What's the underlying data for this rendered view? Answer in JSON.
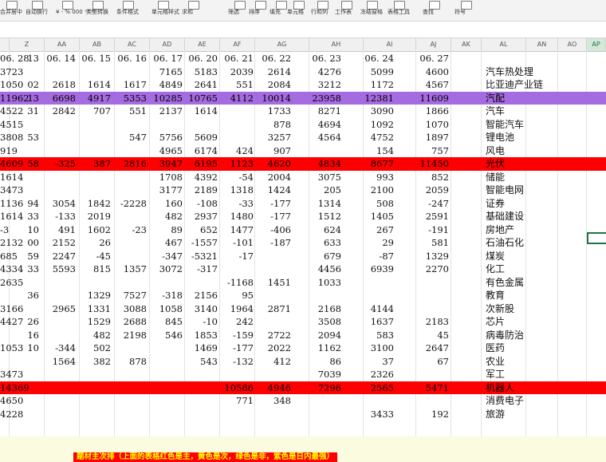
{
  "ribbon": [
    "合并居中",
    "自动换行",
    "¥ - % 000 ⁺⁰ ⁰⁰",
    "类型转换",
    "条件格式",
    "单元格样式",
    "求和",
    "筛选",
    "排序",
    "填充",
    "单元格",
    "行和列",
    "工作表",
    "冻结窗格",
    "表格工具",
    "查找",
    "符号"
  ],
  "columns": [
    "Z",
    "AA",
    "AB",
    "AC",
    "AD",
    "AE",
    "AF",
    "AG",
    "AH",
    "AI",
    "AJ",
    "AK",
    "AL",
    "AN",
    "AO",
    "AP"
  ],
  "rows": [
    {
      "style": "plain",
      "cells": [
        "13",
        "06. 14",
        "06. 15",
        "06. 16",
        "06. 17",
        "06. 20",
        "06. 21",
        "06. 22",
        "06. 23",
        "06. 24",
        "06. 27",
        "06. 28"
      ],
      "label": ""
    },
    {
      "style": "plain",
      "cells": [
        "",
        "",
        "",
        "",
        "7165",
        "5183",
        "2039",
        "2614",
        "4276",
        "5099",
        "4600",
        "3723"
      ],
      "label": "汽车热处理"
    },
    {
      "style": "plain",
      "cells": [
        "02",
        "2618",
        "1614",
        "1617",
        "4849",
        "2641",
        "551",
        "2084",
        "3212",
        "1172",
        "4567",
        "1050"
      ],
      "label": "比亚迪产业链"
    },
    {
      "style": "purple",
      "cells": [
        "13",
        "6698",
        "4917",
        "5353",
        "10285",
        "10765",
        "4112",
        "10014",
        "23958",
        "12381",
        "11609",
        "11962"
      ],
      "label": "汽配"
    },
    {
      "style": "plain",
      "cells": [
        "31",
        "2842",
        "707",
        "551",
        "2137",
        "1614",
        "",
        "1733",
        "8271",
        "3090",
        "1866",
        "4522"
      ],
      "label": "汽车"
    },
    {
      "style": "plain",
      "cells": [
        "",
        "",
        "",
        "",
        "",
        "",
        "",
        "878",
        "4694",
        "1092",
        "1070",
        "4515"
      ],
      "label": "智能汽车"
    },
    {
      "style": "plain",
      "cells": [
        "53",
        "",
        "",
        "547",
        "5756",
        "5609",
        "",
        "3257",
        "4564",
        "4752",
        "1897",
        "3808"
      ],
      "label": "锂电池"
    },
    {
      "style": "plain",
      "cells": [
        "",
        "",
        "",
        "",
        "4965",
        "6174",
        "424",
        "907",
        "",
        "154",
        "757",
        "919"
      ],
      "label": "风电"
    },
    {
      "style": "red",
      "cells": [
        "58",
        "-325",
        "387",
        "2816",
        "3947",
        "6195",
        "1123",
        "4620",
        "4834",
        "8677",
        "11450",
        "4609"
      ],
      "label": "光伏"
    },
    {
      "style": "plain",
      "cells": [
        "",
        "",
        "",
        "",
        "1708",
        "4392",
        "-54",
        "2004",
        "3075",
        "993",
        "852",
        "1614"
      ],
      "label": "储能"
    },
    {
      "style": "plain",
      "cells": [
        "",
        "",
        "",
        "",
        "3177",
        "2189",
        "1318",
        "1424",
        "205",
        "2100",
        "2059",
        "3473"
      ],
      "label": "智能电网"
    },
    {
      "style": "plain",
      "cells": [
        "94",
        "3054",
        "1842",
        "-2228",
        "160",
        "-108",
        "-33",
        "-177",
        "1314",
        "508",
        "-247",
        "1136"
      ],
      "label": "证券"
    },
    {
      "style": "plain",
      "cells": [
        "33",
        "-133",
        "2019",
        "",
        "482",
        "2937",
        "1480",
        "-177",
        "1512",
        "1405",
        "2591",
        "1614"
      ],
      "label": "基础建设"
    },
    {
      "style": "plain",
      "cells": [
        "10",
        "491",
        "1602",
        "-23",
        "89",
        "652",
        "1477",
        "-406",
        "624",
        "267",
        "-191",
        "-3"
      ],
      "label": "房地产"
    },
    {
      "style": "plain",
      "cells": [
        "00",
        "2152",
        "26",
        "",
        "467",
        "-1557",
        "-101",
        "-187",
        "633",
        "29",
        "581",
        "2132"
      ],
      "label": "石油石化"
    },
    {
      "style": "plain",
      "cells": [
        "59",
        "2247",
        "-45",
        "",
        "-347",
        "-5321",
        "-17",
        "",
        "679",
        "-87",
        "1329",
        "685"
      ],
      "label": "煤炭"
    },
    {
      "style": "plain",
      "cells": [
        "33",
        "5593",
        "815",
        "1357",
        "3072",
        "-317",
        "",
        "",
        "4456",
        "6939",
        "2270",
        "4334"
      ],
      "label": "化工"
    },
    {
      "style": "plain",
      "cells": [
        "",
        "",
        "",
        "",
        "",
        "",
        "-1168",
        "1451",
        "1033",
        "",
        "",
        "2635"
      ],
      "label": "有色金属"
    },
    {
      "style": "plain",
      "cells": [
        "36",
        "",
        "1329",
        "7527",
        "-318",
        "2156",
        "95",
        "",
        "",
        "",
        "",
        ""
      ],
      "label": "教育"
    },
    {
      "style": "plain",
      "cells": [
        "",
        "2965",
        "1331",
        "3088",
        "1058",
        "3140",
        "1964",
        "2871",
        "2168",
        "4144",
        "",
        "3166"
      ],
      "label": "次新股"
    },
    {
      "style": "plain",
      "cells": [
        "26",
        "",
        "1529",
        "2688",
        "845",
        "-10",
        "242",
        "",
        "3508",
        "1637",
        "2183",
        "4427"
      ],
      "label": "芯片"
    },
    {
      "style": "plain",
      "cells": [
        "16",
        "",
        "482",
        "2198",
        "546",
        "1853",
        "-159",
        "2722",
        "2094",
        "583",
        "45",
        ""
      ],
      "label": "病毒防治"
    },
    {
      "style": "plain",
      "cells": [
        "10",
        "-344",
        "502",
        "",
        "",
        "1469",
        "-177",
        "2022",
        "1162",
        "3100",
        "2647",
        "1053"
      ],
      "label": "医药"
    },
    {
      "style": "plain",
      "cells": [
        "",
        "1564",
        "382",
        "878",
        "",
        "543",
        "-132",
        "412",
        "86",
        "37",
        "67",
        ""
      ],
      "label": "农业"
    },
    {
      "style": "plain",
      "cells": [
        "",
        "",
        "",
        "",
        "",
        "",
        "",
        "",
        "7039",
        "2326",
        "",
        "3473"
      ],
      "label": "军工"
    },
    {
      "style": "red",
      "cells": [
        "",
        "",
        "",
        "",
        "",
        "",
        "10586",
        "4946",
        "7296",
        "2565",
        "5471",
        "14369"
      ],
      "label": "机器人"
    },
    {
      "style": "plain",
      "cells": [
        "",
        "",
        "",
        "",
        "",
        "",
        "771",
        "348",
        "",
        "",
        "",
        "4650"
      ],
      "label": "消费电子"
    },
    {
      "style": "plain",
      "cells": [
        "",
        "",
        "",
        "",
        "",
        "",
        "",
        "",
        "",
        "3433",
        "192",
        "4228"
      ],
      "label": "旅游"
    }
  ],
  "note": "题材主次排（上面的表格红色是主，黄色是次，绿色是非，紫色是日内最强）",
  "colors": {
    "red": "#ff0000",
    "purple": "#a56be0",
    "note_text": "#ffff00",
    "selection": "#217346"
  }
}
